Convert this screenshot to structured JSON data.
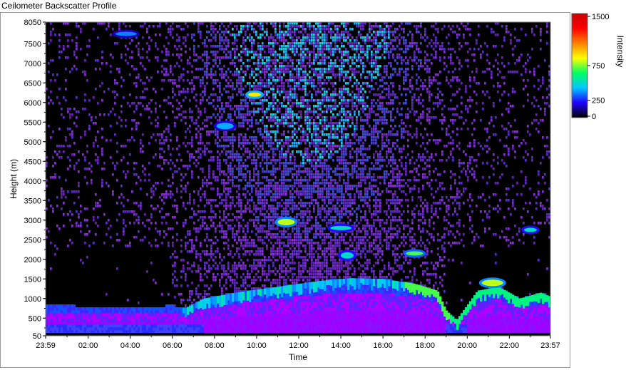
{
  "window": {
    "title": "Ceilometer Backscatter Profile"
  },
  "chart_data": {
    "type": "heatmap",
    "title": "Ceilometer Backscatter Profile",
    "xlabel": "Time",
    "ylabel": "Height (m)",
    "x_tick_labels": [
      "23:59",
      "02:00",
      "04:00",
      "06:00",
      "08:00",
      "10:00",
      "12:00",
      "14:00",
      "16:00",
      "18:00",
      "20:00",
      "22:00",
      "23:57"
    ],
    "x_tick_hours": [
      -0.017,
      2,
      4,
      6,
      8,
      10,
      12,
      14,
      16,
      18,
      20,
      22,
      23.95
    ],
    "xlim_hours": [
      -0.017,
      23.95
    ],
    "y_ticks": [
      50,
      500,
      1000,
      1500,
      2000,
      2500,
      3000,
      3500,
      4000,
      4500,
      5000,
      5500,
      6000,
      6500,
      7000,
      7500,
      8050
    ],
    "ylim": [
      50,
      8050
    ],
    "colorbar": {
      "label": "Intensity",
      "ticks": [
        0,
        250,
        750,
        1500
      ],
      "range": [
        0,
        1500
      ],
      "colors": [
        "#000000",
        "#2000ff",
        "#00c8ff",
        "#00ff60",
        "#ffff00",
        "#ff8000",
        "#ff0000",
        "#c80000"
      ]
    },
    "features": {
      "boundary_layer_top": {
        "hours": [
          0,
          2,
          4,
          6,
          6.6,
          7.5,
          9,
          11,
          13,
          14.5,
          16,
          17.5,
          18.6,
          19,
          19.5,
          20.5,
          21.5,
          22.5,
          23.5,
          23.95
        ],
        "heights": [
          850,
          800,
          780,
          820,
          750,
          1000,
          1150,
          1300,
          1450,
          1520,
          1500,
          1380,
          1200,
          700,
          450,
          1200,
          1300,
          1000,
          1150,
          1050
        ]
      },
      "cloud_patches": [
        {
          "hour": 9.9,
          "height": 6200,
          "intensity": 900
        },
        {
          "hour": 11.4,
          "height": 2950,
          "intensity": 800
        },
        {
          "hour": 14.0,
          "height": 2800,
          "intensity": 500
        },
        {
          "hour": 14.3,
          "height": 2100,
          "intensity": 500
        },
        {
          "hour": 17.5,
          "height": 2150,
          "intensity": 700
        },
        {
          "hour": 21.2,
          "height": 1400,
          "intensity": 800
        },
        {
          "hour": 23.0,
          "height": 2750,
          "intensity": 500
        },
        {
          "hour": 8.5,
          "height": 5400,
          "intensity": 400
        },
        {
          "hour": 3.8,
          "height": 7750,
          "intensity": 350
        }
      ]
    }
  }
}
